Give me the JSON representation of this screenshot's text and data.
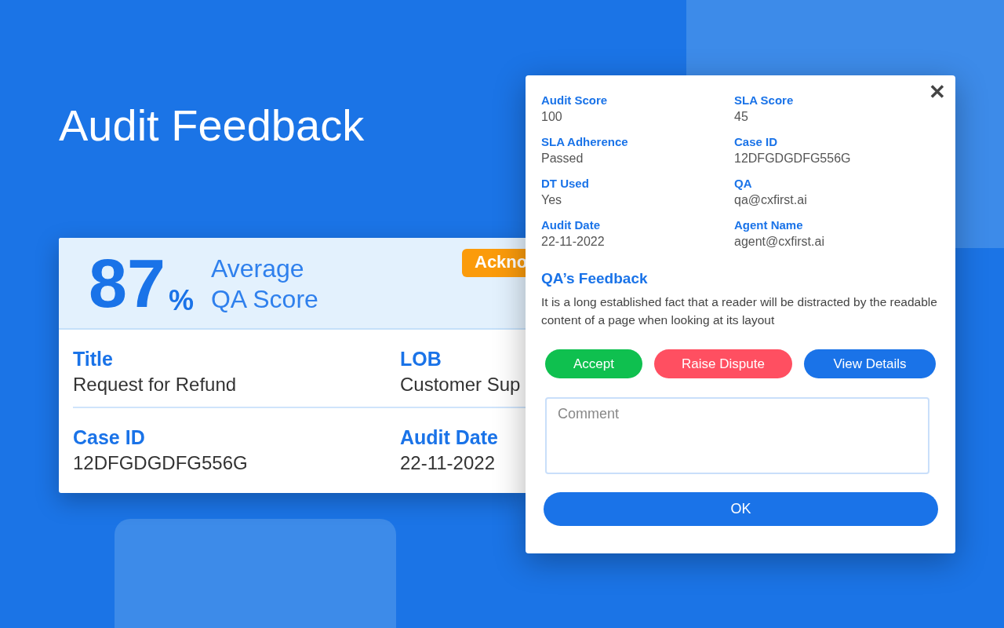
{
  "heading": "Audit Feedback",
  "summary_card": {
    "score": "87",
    "percent": "%",
    "score_label": "Average QA Score",
    "badge": "Ackno",
    "fields": [
      {
        "label": "Title",
        "value": "Request for Refund"
      },
      {
        "label": "LOB",
        "value": "Customer Sup"
      },
      {
        "label": "Case ID",
        "value": "12DFGDGDFG556G"
      },
      {
        "label": "Audit Date",
        "value": "22-11-2022"
      }
    ]
  },
  "dialog": {
    "close": "✕",
    "fields": [
      {
        "label": "Audit Score",
        "value": "100"
      },
      {
        "label": "SLA Score",
        "value": "45"
      },
      {
        "label": "SLA Adherence",
        "value": "Passed"
      },
      {
        "label": "Case ID",
        "value": "12DFGDGDFG556G"
      },
      {
        "label": "DT Used",
        "value": "Yes"
      },
      {
        "label": "QA",
        "value": "qa@cxfirst.ai"
      },
      {
        "label": "Audit Date",
        "value": "22-11-2022"
      },
      {
        "label": "Agent Name",
        "value": "agent@cxfirst.ai"
      }
    ],
    "feedback_title": "QA’s Feedback",
    "feedback_text": "It is a long established fact that a reader will be distracted by the readable content of a page when looking at its layout",
    "actions": [
      {
        "label": "Accept",
        "kind": "accept"
      },
      {
        "label": "Raise Dispute",
        "kind": "dispute"
      },
      {
        "label": "View Details",
        "kind": "details"
      }
    ],
    "comment": {
      "placeholder": "Comment"
    },
    "ok": "OK"
  }
}
